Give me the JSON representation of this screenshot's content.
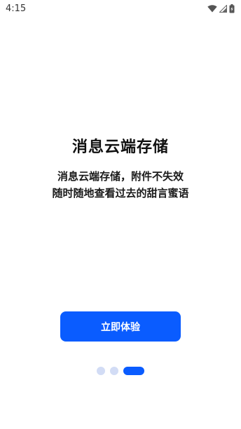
{
  "status_bar": {
    "time": "4:15",
    "icons": [
      "wifi-icon",
      "signal-icon",
      "battery-charging-icon"
    ]
  },
  "onboarding": {
    "title": "消息云端存储",
    "description_lines": [
      "消息云端存储，附件不失效",
      "随时随地查看过去的甜言蜜语"
    ],
    "cta_label": "立即体验",
    "page_count": 3,
    "current_page": 3
  },
  "colors": {
    "accent": "#0a5cff",
    "inactive_dot": "#d2dcf5",
    "background": "#ffffff"
  }
}
